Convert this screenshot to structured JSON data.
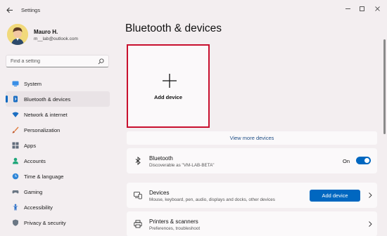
{
  "window": {
    "title": "Settings",
    "controls": {
      "minimize": "—",
      "maximize": "☐",
      "close": "✕"
    }
  },
  "profile": {
    "name": "Mauro H.",
    "email": "m__lab@outlook.com"
  },
  "search": {
    "placeholder": "Find a setting"
  },
  "sidebar": {
    "items": [
      {
        "label": "System",
        "icon": "monitor-icon",
        "active": false
      },
      {
        "label": "Bluetooth & devices",
        "icon": "bluetooth-devices-icon",
        "active": true
      },
      {
        "label": "Network & internet",
        "icon": "wifi-icon",
        "active": false
      },
      {
        "label": "Personalization",
        "icon": "brush-icon",
        "active": false
      },
      {
        "label": "Apps",
        "icon": "apps-icon",
        "active": false
      },
      {
        "label": "Accounts",
        "icon": "person-icon",
        "active": false
      },
      {
        "label": "Time & language",
        "icon": "globe-clock-icon",
        "active": false
      },
      {
        "label": "Gaming",
        "icon": "gamepad-icon",
        "active": false
      },
      {
        "label": "Accessibility",
        "icon": "accessibility-icon",
        "active": false
      },
      {
        "label": "Privacy & security",
        "icon": "shield-icon",
        "active": false
      }
    ]
  },
  "main": {
    "title": "Bluetooth & devices",
    "add_tile_label": "Add device",
    "view_more_label": "View more devices",
    "bluetooth": {
      "title": "Bluetooth",
      "subtitle": "Discoverable as \"VM-LAB-BETA\"",
      "state_label": "On",
      "enabled": true
    },
    "devices": {
      "title": "Devices",
      "subtitle": "Mouse, keyboard, pen, audio, displays and docks, other devices",
      "button_label": "Add device"
    },
    "printers": {
      "title": "Printers & scanners",
      "subtitle": "Preferences, troubleshoot"
    }
  },
  "colors": {
    "accent": "#0067c0",
    "highlight_border": "#c8102e",
    "background": "#f3eef0",
    "card": "#fbf9fa"
  }
}
